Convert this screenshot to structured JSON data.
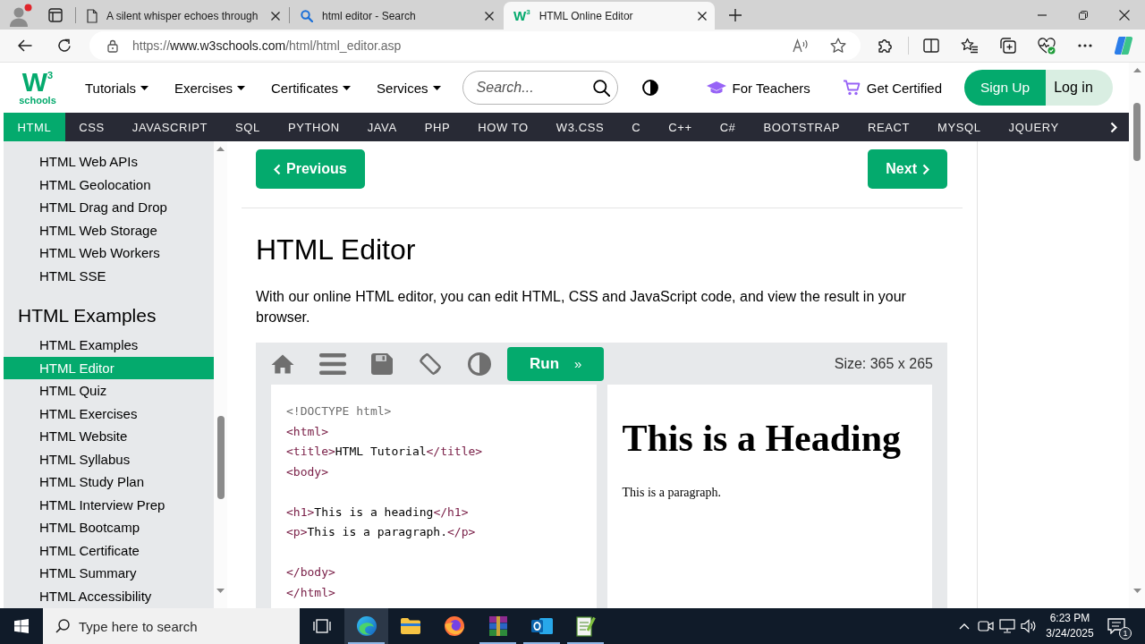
{
  "browser": {
    "tabs": [
      {
        "kind": "page",
        "title": "A silent whisper echoes through",
        "selected": false
      },
      {
        "kind": "search",
        "title": "html editor - Search",
        "selected": false
      },
      {
        "kind": "site",
        "favicon": {
          "mark": "W",
          "sup": "3"
        },
        "title": "HTML Online Editor",
        "selected": true
      }
    ],
    "address": {
      "scheme": "https://",
      "host": "www.w3schools.com",
      "path": "/html/html_editor.asp"
    }
  },
  "site_header": {
    "logo": {
      "mark": "W",
      "sup": "3",
      "word": "schools"
    },
    "menus": [
      "Tutorials",
      "Exercises",
      "Certificates",
      "Services"
    ],
    "search": {
      "placeholder": "Search..."
    },
    "links": [
      {
        "kind": "teachers",
        "label": "For Teachers"
      },
      {
        "kind": "cart",
        "label": "Get Certified"
      }
    ],
    "sign_up": "Sign Up",
    "log_in": "Log in"
  },
  "topnav": [
    {
      "label": "HTML",
      "selected": true
    },
    {
      "label": "CSS",
      "selected": false
    },
    {
      "label": "JAVASCRIPT",
      "selected": false
    },
    {
      "label": "SQL",
      "selected": false
    },
    {
      "label": "PYTHON",
      "selected": false
    },
    {
      "label": "JAVA",
      "selected": false
    },
    {
      "label": "PHP",
      "selected": false
    },
    {
      "label": "HOW TO",
      "selected": false
    },
    {
      "label": "W3.CSS",
      "selected": false
    },
    {
      "label": "C",
      "selected": false
    },
    {
      "label": "C++",
      "selected": false
    },
    {
      "label": "C#",
      "selected": false
    },
    {
      "label": "BOOTSTRAP",
      "selected": false
    },
    {
      "label": "REACT",
      "selected": false
    },
    {
      "label": "MYSQL",
      "selected": false
    },
    {
      "label": "JQUERY",
      "selected": false
    }
  ],
  "sidebar": {
    "groups": [
      {
        "items": [
          {
            "label": "HTML Web APIs",
            "selected": false
          },
          {
            "label": "HTML Geolocation",
            "selected": false
          },
          {
            "label": "HTML Drag and Drop",
            "selected": false
          },
          {
            "label": "HTML Web Storage",
            "selected": false
          },
          {
            "label": "HTML Web Workers",
            "selected": false
          },
          {
            "label": "HTML SSE",
            "selected": false
          }
        ]
      },
      {
        "heading": "HTML Examples",
        "items": [
          {
            "label": "HTML Examples",
            "selected": false
          },
          {
            "label": "HTML Editor",
            "selected": true
          },
          {
            "label": "HTML Quiz",
            "selected": false
          },
          {
            "label": "HTML Exercises",
            "selected": false
          },
          {
            "label": "HTML Website",
            "selected": false
          },
          {
            "label": "HTML Syllabus",
            "selected": false
          },
          {
            "label": "HTML Study Plan",
            "selected": false
          },
          {
            "label": "HTML Interview Prep",
            "selected": false
          },
          {
            "label": "HTML Bootcamp",
            "selected": false
          },
          {
            "label": "HTML Certificate",
            "selected": false
          },
          {
            "label": "HTML Summary",
            "selected": false
          },
          {
            "label": "HTML Accessibility",
            "selected": false
          }
        ]
      }
    ]
  },
  "main": {
    "previous": "Previous",
    "next": "Next",
    "title": "HTML Editor",
    "intro": "With our online HTML editor, you can edit HTML, CSS and JavaScript code, and view the result in your browser.",
    "editor": {
      "run": "Run",
      "run_arrow": "»",
      "size": "Size: 365 x 265",
      "code": [
        [
          [
            {
              "kind": "doctype",
              "text": "<!DOCTYPE html>"
            }
          ],
          [
            {
              "kind": "tag",
              "text": "<html>"
            }
          ],
          [
            {
              "kind": "tag",
              "text": "<title>"
            },
            {
              "kind": "text",
              "text": "HTML Tutorial"
            },
            {
              "kind": "tag",
              "text": "</title>"
            }
          ],
          [
            {
              "kind": "tag",
              "text": "<body>"
            }
          ]
        ],
        [
          [
            {
              "kind": "tag",
              "text": "<h1>"
            },
            {
              "kind": "text",
              "text": "This is a heading"
            },
            {
              "kind": "tag",
              "text": "</h1>"
            }
          ],
          [
            {
              "kind": "tag",
              "text": "<p>"
            },
            {
              "kind": "text",
              "text": "This is a paragraph."
            },
            {
              "kind": "tag",
              "text": "</p>"
            }
          ]
        ],
        [
          [
            {
              "kind": "tag",
              "text": "</body>"
            }
          ],
          [
            {
              "kind": "tag",
              "text": "</html>"
            }
          ]
        ]
      ],
      "result": {
        "heading": "This is a Heading",
        "paragraph": "This is a paragraph."
      }
    }
  },
  "taskbar": {
    "search": {
      "placeholder": "Type here to search"
    },
    "apps": [
      {
        "kind": "edge",
        "selected": true,
        "running": true
      },
      {
        "kind": "explorer",
        "selected": false,
        "running": false
      },
      {
        "kind": "firefox",
        "selected": false,
        "running": false
      },
      {
        "kind": "winrar",
        "selected": false,
        "running": true
      },
      {
        "kind": "outlook",
        "selected": false,
        "running": true
      },
      {
        "kind": "notepad",
        "selected": false,
        "running": true
      }
    ],
    "time": "6:23 PM",
    "date": "3/24/2025",
    "notifications": "1"
  }
}
